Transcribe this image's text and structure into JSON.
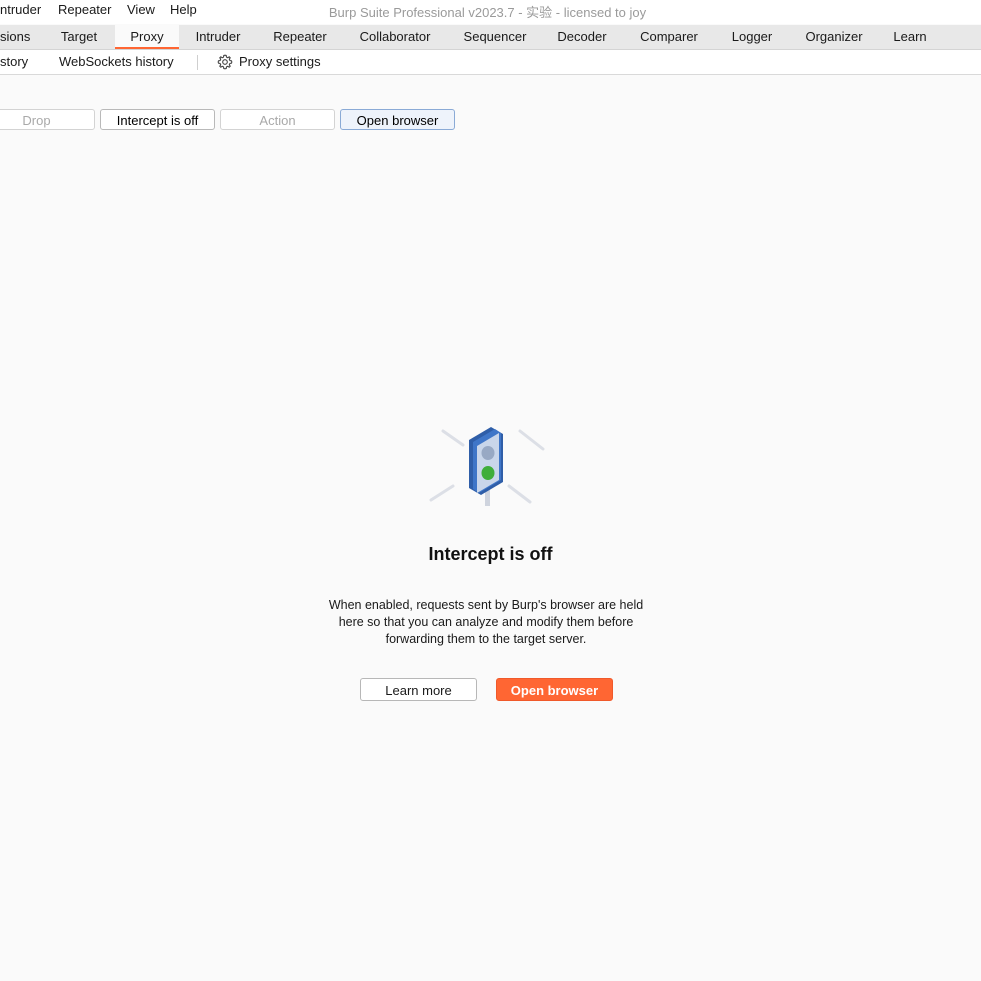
{
  "menubar": {
    "items": [
      "ntruder",
      "Repeater",
      "View",
      "Help"
    ],
    "window_title": "Burp Suite Professional v2023.7 - 实验 - licensed to joy"
  },
  "main_tabs": {
    "items": [
      "sions",
      "Target",
      "Proxy",
      "Intruder",
      "Repeater",
      "Collaborator",
      "Sequencer",
      "Decoder",
      "Comparer",
      "Logger",
      "Organizer",
      "Learn"
    ],
    "active": "Proxy",
    "accent_color": "#ff6633"
  },
  "proxy_subtabs": {
    "items": [
      "story",
      "WebSockets history"
    ],
    "settings_label": "Proxy settings",
    "settings_icon": "gear-icon"
  },
  "toolbar": {
    "drop_label": "Drop",
    "intercept_toggle_label": "Intercept is off",
    "action_label": "Action",
    "open_browser_label": "Open browser"
  },
  "empty_state": {
    "icon": "traffic-light-icon",
    "title": "Intercept is off",
    "description_lines": [
      "When enabled, requests sent by Burp's browser are held",
      "here so that you can analyze and modify them before",
      "forwarding them to the target server."
    ],
    "learn_more_label": "Learn more",
    "open_browser_label": "Open browser",
    "primary_color": "#ff6633"
  }
}
